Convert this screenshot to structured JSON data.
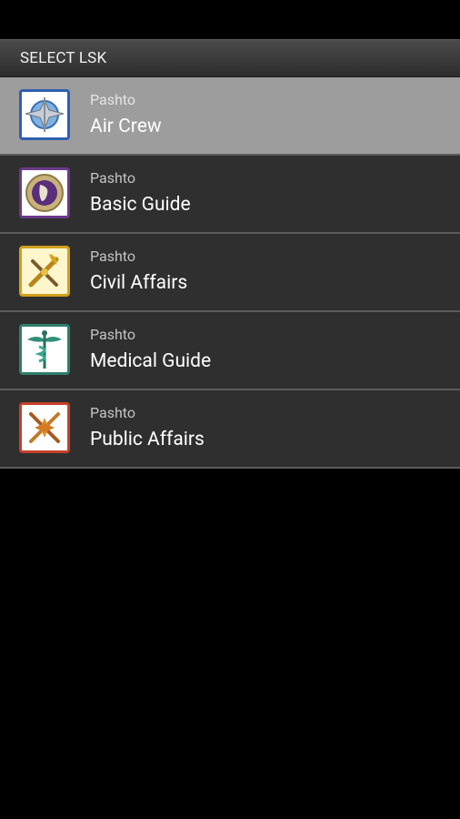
{
  "header": {
    "title": "SELECT LSK"
  },
  "items": [
    {
      "language": "Pashto",
      "title": "Air Crew",
      "icon": "air-crew-emblem-icon",
      "selected": true,
      "frame_color": "#2f5fb0"
    },
    {
      "language": "Pashto",
      "title": "Basic Guide",
      "icon": "basic-guide-emblem-icon",
      "selected": false,
      "frame_color": "#6a3a8a"
    },
    {
      "language": "Pashto",
      "title": "Civil Affairs",
      "icon": "civil-affairs-emblem-icon",
      "selected": false,
      "frame_color": "#d1a01a"
    },
    {
      "language": "Pashto",
      "title": "Medical Guide",
      "icon": "medical-guide-emblem-icon",
      "selected": false,
      "frame_color": "#2e7f6b"
    },
    {
      "language": "Pashto",
      "title": "Public Affairs",
      "icon": "public-affairs-emblem-icon",
      "selected": false,
      "frame_color": "#c4412a"
    }
  ],
  "colors": {
    "selected_background": "#9d9d9d",
    "item_background": "#2f2f2f",
    "divider": "#5c5c5c"
  }
}
